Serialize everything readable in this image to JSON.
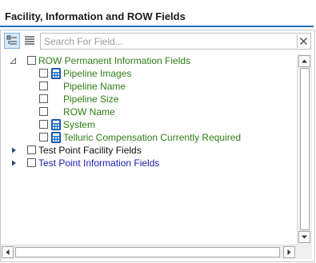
{
  "header": {
    "title": "Facility, Information and ROW Fields"
  },
  "toolbar": {
    "categorized_icon": "categorized-view-icon",
    "list_icon": "list-view-icon",
    "search_placeholder": "Search For Field...",
    "clear_icon": "clear-x-icon"
  },
  "tree": {
    "groups": [
      {
        "label": "ROW Permanent Information Fields",
        "expanded": true,
        "color": "#2e7d16",
        "items": [
          {
            "label": "Pipeline Images",
            "has_icon": true,
            "icon": "calculator-field-icon"
          },
          {
            "label": "Pipeline Name",
            "has_icon": false
          },
          {
            "label": "Pipeline Size",
            "has_icon": false
          },
          {
            "label": "ROW Name",
            "has_icon": false
          },
          {
            "label": "System",
            "has_icon": true,
            "icon": "calculator-field-icon"
          },
          {
            "label": "Telluric Compensation Currently Required",
            "has_icon": true,
            "icon": "calculator-field-icon"
          }
        ]
      },
      {
        "label": "Test Point Facility Fields",
        "expanded": false,
        "color": "#111111"
      },
      {
        "label": "Test Point Information Fields",
        "expanded": false,
        "color": "#1a1ab0"
      }
    ]
  },
  "colors": {
    "accent": "#2b6cb8",
    "green_text": "#2e7d16",
    "blue_text": "#1a1ab0"
  }
}
